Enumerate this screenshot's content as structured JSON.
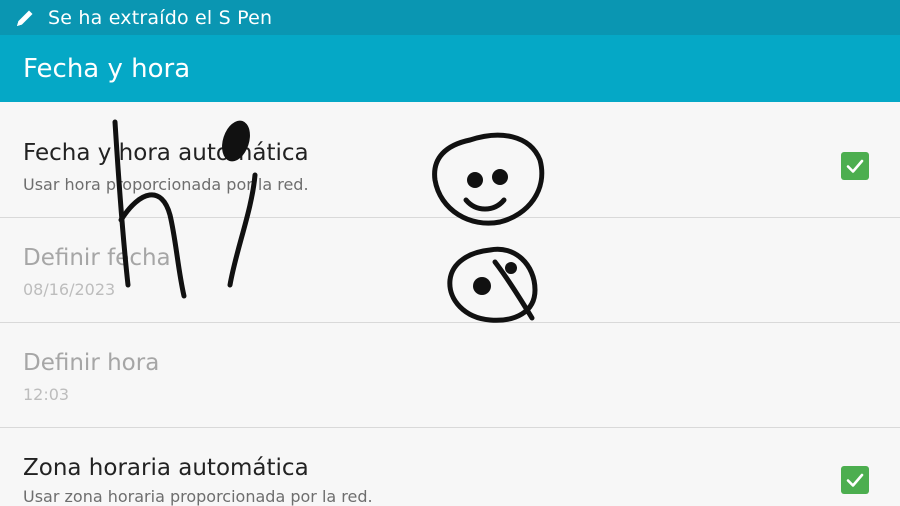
{
  "status_bar": {
    "message": "Se ha extraído el S Pen",
    "icon": "pen-icon"
  },
  "action_bar": {
    "title": "Fecha y hora"
  },
  "settings": [
    {
      "title": "Fecha y hora automática",
      "summary": "Usar hora proporcionada por la red.",
      "checked": true,
      "enabled": true
    },
    {
      "title": "Definir fecha",
      "summary": "08/16/2023",
      "enabled": false
    },
    {
      "title": "Definir hora",
      "summary": "12:03",
      "enabled": false
    },
    {
      "title": "Zona horaria automática",
      "summary": "Usar zona horaria proporcionada por la red.",
      "checked": true,
      "enabled": true
    }
  ],
  "colors": {
    "status_bar_bg": "#0a96b2",
    "action_bar_bg": "#05a8c6",
    "checkbox": "#4cae4f"
  }
}
